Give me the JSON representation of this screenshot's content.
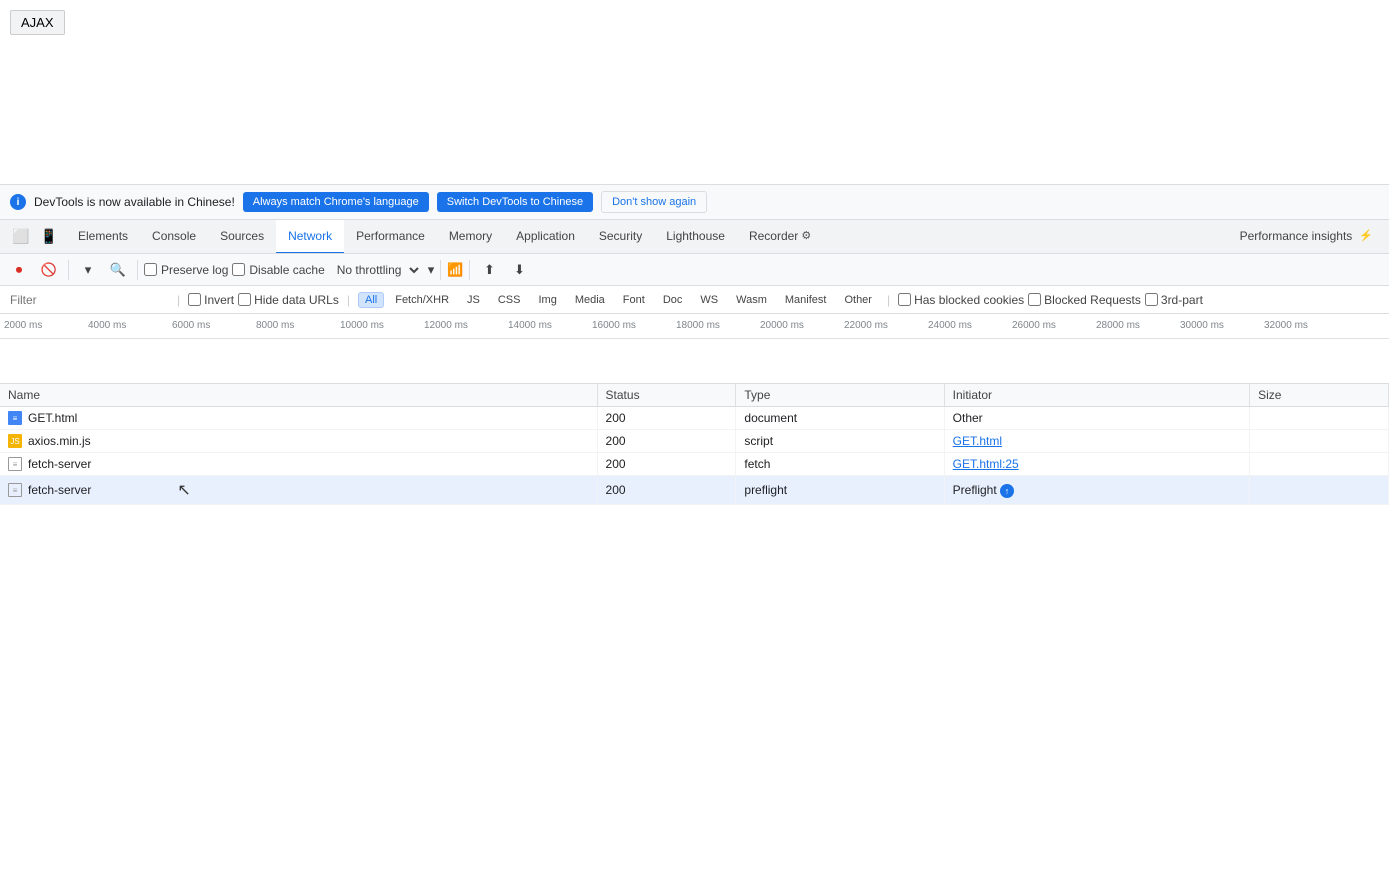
{
  "page": {
    "ajax_button": "AJAX"
  },
  "notification": {
    "info_icon": "i",
    "message": "DevTools is now available in Chinese!",
    "btn_match": "Always match Chrome's language",
    "btn_switch": "Switch DevTools to Chinese",
    "btn_dismiss": "Don't show again"
  },
  "tabs": {
    "items": [
      {
        "id": "elements",
        "label": "Elements",
        "active": false
      },
      {
        "id": "console",
        "label": "Console",
        "active": false
      },
      {
        "id": "sources",
        "label": "Sources",
        "active": false
      },
      {
        "id": "network",
        "label": "Network",
        "active": true
      },
      {
        "id": "performance",
        "label": "Performance",
        "active": false
      },
      {
        "id": "memory",
        "label": "Memory",
        "active": false
      },
      {
        "id": "application",
        "label": "Application",
        "active": false
      },
      {
        "id": "security",
        "label": "Security",
        "active": false
      },
      {
        "id": "lighthouse",
        "label": "Lighthouse",
        "active": false
      },
      {
        "id": "recorder",
        "label": "Recorder",
        "active": false
      },
      {
        "id": "performance_insights",
        "label": "Performance insights",
        "active": false
      }
    ]
  },
  "toolbar": {
    "preserve_log_label": "Preserve log",
    "disable_cache_label": "Disable cache",
    "throttle_label": "No throttling"
  },
  "filter": {
    "placeholder": "Filter",
    "invert_label": "Invert",
    "hide_data_urls_label": "Hide data URLs",
    "types": [
      "All",
      "Fetch/XHR",
      "JS",
      "CSS",
      "Img",
      "Media",
      "Font",
      "Doc",
      "WS",
      "Wasm",
      "Manifest",
      "Other"
    ],
    "active_type": "All",
    "has_blocked_cookies_label": "Has blocked cookies",
    "blocked_requests_label": "Blocked Requests",
    "third_party_label": "3rd-part"
  },
  "timeline": {
    "ticks": [
      "2000 ms",
      "4000 ms",
      "6000 ms",
      "8000 ms",
      "10000 ms",
      "12000 ms",
      "14000 ms",
      "16000 ms",
      "18000 ms",
      "20000 ms",
      "22000 ms",
      "24000 ms",
      "26000 ms",
      "28000 ms",
      "30000 ms",
      "32000 ms"
    ]
  },
  "table": {
    "columns": [
      "Name",
      "Status",
      "Type",
      "Initiator",
      "Size"
    ],
    "rows": [
      {
        "name": "GET.html",
        "icon": "doc",
        "status": "200",
        "type": "document",
        "initiator": "Other",
        "initiator_link": false,
        "size": ""
      },
      {
        "name": "axios.min.js",
        "icon": "js",
        "status": "200",
        "type": "script",
        "initiator": "GET.html",
        "initiator_link": true,
        "size": ""
      },
      {
        "name": "fetch-server",
        "icon": "fetch",
        "status": "200",
        "type": "fetch",
        "initiator": "GET.html:25",
        "initiator_link": true,
        "size": ""
      },
      {
        "name": "fetch-server",
        "icon": "fetch",
        "status": "200",
        "type": "preflight",
        "initiator": "Preflight",
        "initiator_link": true,
        "initiator_icon": true,
        "size": ""
      }
    ]
  }
}
